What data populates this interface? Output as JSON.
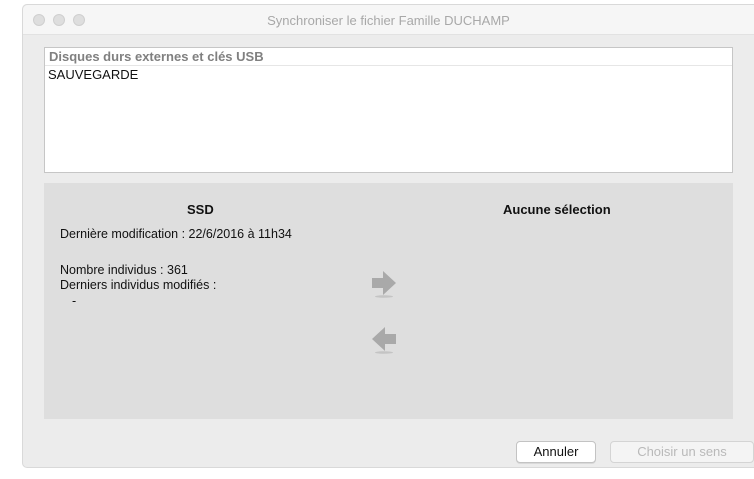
{
  "window": {
    "title": "Synchroniser le fichier Famille DUCHAMP"
  },
  "devices": {
    "header": "Disques durs externes et clés USB",
    "items": [
      "SAUVEGARDE"
    ]
  },
  "left": {
    "title": "SSD",
    "last_modified": "Dernière modification : 22/6/2016 à 11h34",
    "count": "Nombre individus : 361",
    "recent_label": "Derniers individus modifiés :",
    "recent_value": "-"
  },
  "right": {
    "title": "Aucune sélection"
  },
  "arrows": {
    "right_icon": "arrow-right-icon",
    "left_icon": "arrow-left-icon",
    "color": "#a9a9a9"
  },
  "buttons": {
    "cancel": "Annuler",
    "choose": "Choisir un sens"
  }
}
